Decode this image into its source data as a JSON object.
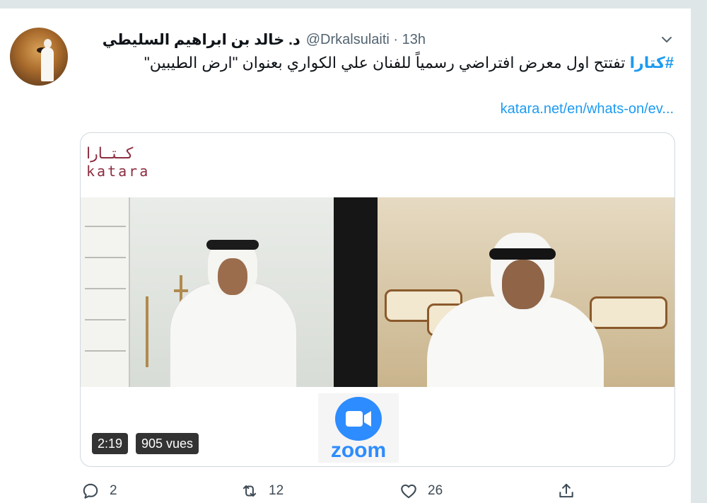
{
  "tweet": {
    "author_name": "د. خالد بن ابراهيم السليطي",
    "handle": "@Drkalsulaiti",
    "time": "13h",
    "hashtag": "#كتارا",
    "text": "تفتتح اول معرض افتراضي رسمياً للفنان علي الكواري بعنوان \"ارض الطيبين\"",
    "link": "katara.net/en/whats-on/ev..."
  },
  "media": {
    "logo_ar": "كــتــارا",
    "logo_en": "katara",
    "zoom_label": "zoom",
    "duration": "2:19",
    "views": "905 vues"
  },
  "actions": {
    "reply_count": "2",
    "retweet_count": "12",
    "like_count": "26"
  },
  "colors": {
    "accent": "#1d9bf0",
    "katara": "#8b2d3f",
    "zoom": "#2d8cff"
  },
  "icons": [
    "chevron-down-icon",
    "reply-icon",
    "retweet-icon",
    "like-icon",
    "share-icon",
    "video-camera-icon"
  ]
}
